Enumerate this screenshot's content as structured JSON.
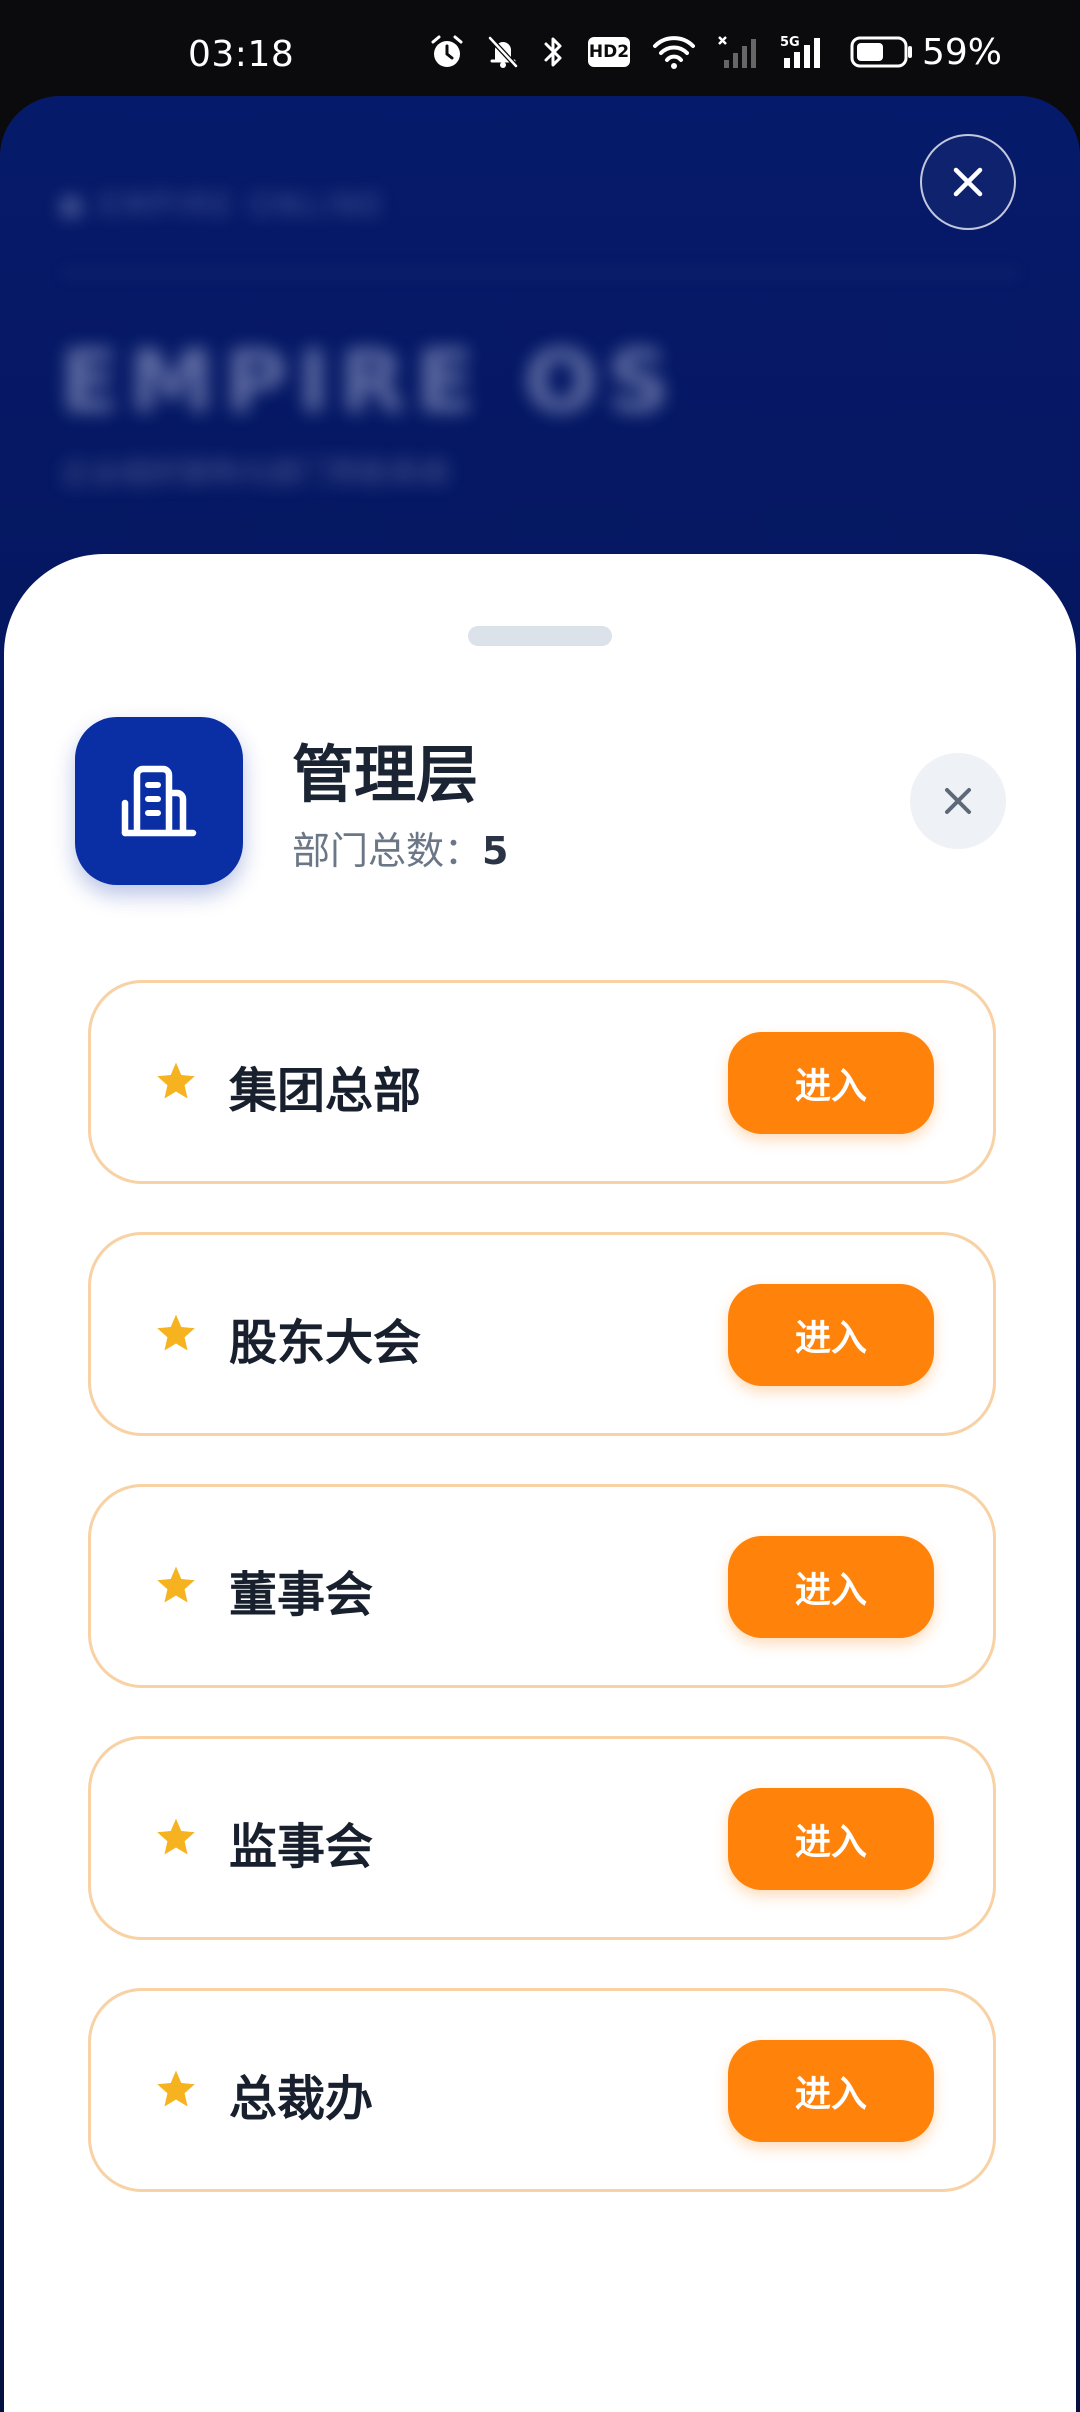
{
  "status_bar": {
    "time": "03:18",
    "battery_percent": "59%",
    "battery_level": 0.59,
    "icons": [
      "alarm-icon",
      "mute-icon",
      "bluetooth-icon",
      "hd-voice-icon",
      "wifi-icon",
      "signal-icon",
      "5g-signal-icon",
      "battery-icon"
    ],
    "hd_label": "HD2",
    "network_label": "5G"
  },
  "background_app": {
    "brand": "EMPIRE ONLINE",
    "title": "EMPIRE OS",
    "subtitle": "企业组织架构与部门导航系统",
    "close_icon": "close-icon"
  },
  "sheet": {
    "title": "管理层",
    "count_label": "部门总数：",
    "count_value": "5",
    "header_icon": "building-icon",
    "close_icon": "close-icon",
    "items": [
      {
        "icon": "star-icon",
        "name": "集团总部",
        "button": "进入"
      },
      {
        "icon": "star-icon",
        "name": "股东大会",
        "button": "进入"
      },
      {
        "icon": "star-icon",
        "name": "董事会",
        "button": "进入"
      },
      {
        "icon": "star-icon",
        "name": "监事会",
        "button": "进入"
      },
      {
        "icon": "star-icon",
        "name": "总裁办",
        "button": "进入"
      }
    ]
  },
  "colors": {
    "primary": "#0a2fa4",
    "accent": "#ff820a",
    "star": "#f6b21f",
    "card_border": "#f8d1a4",
    "background_app": "#061a6b"
  }
}
